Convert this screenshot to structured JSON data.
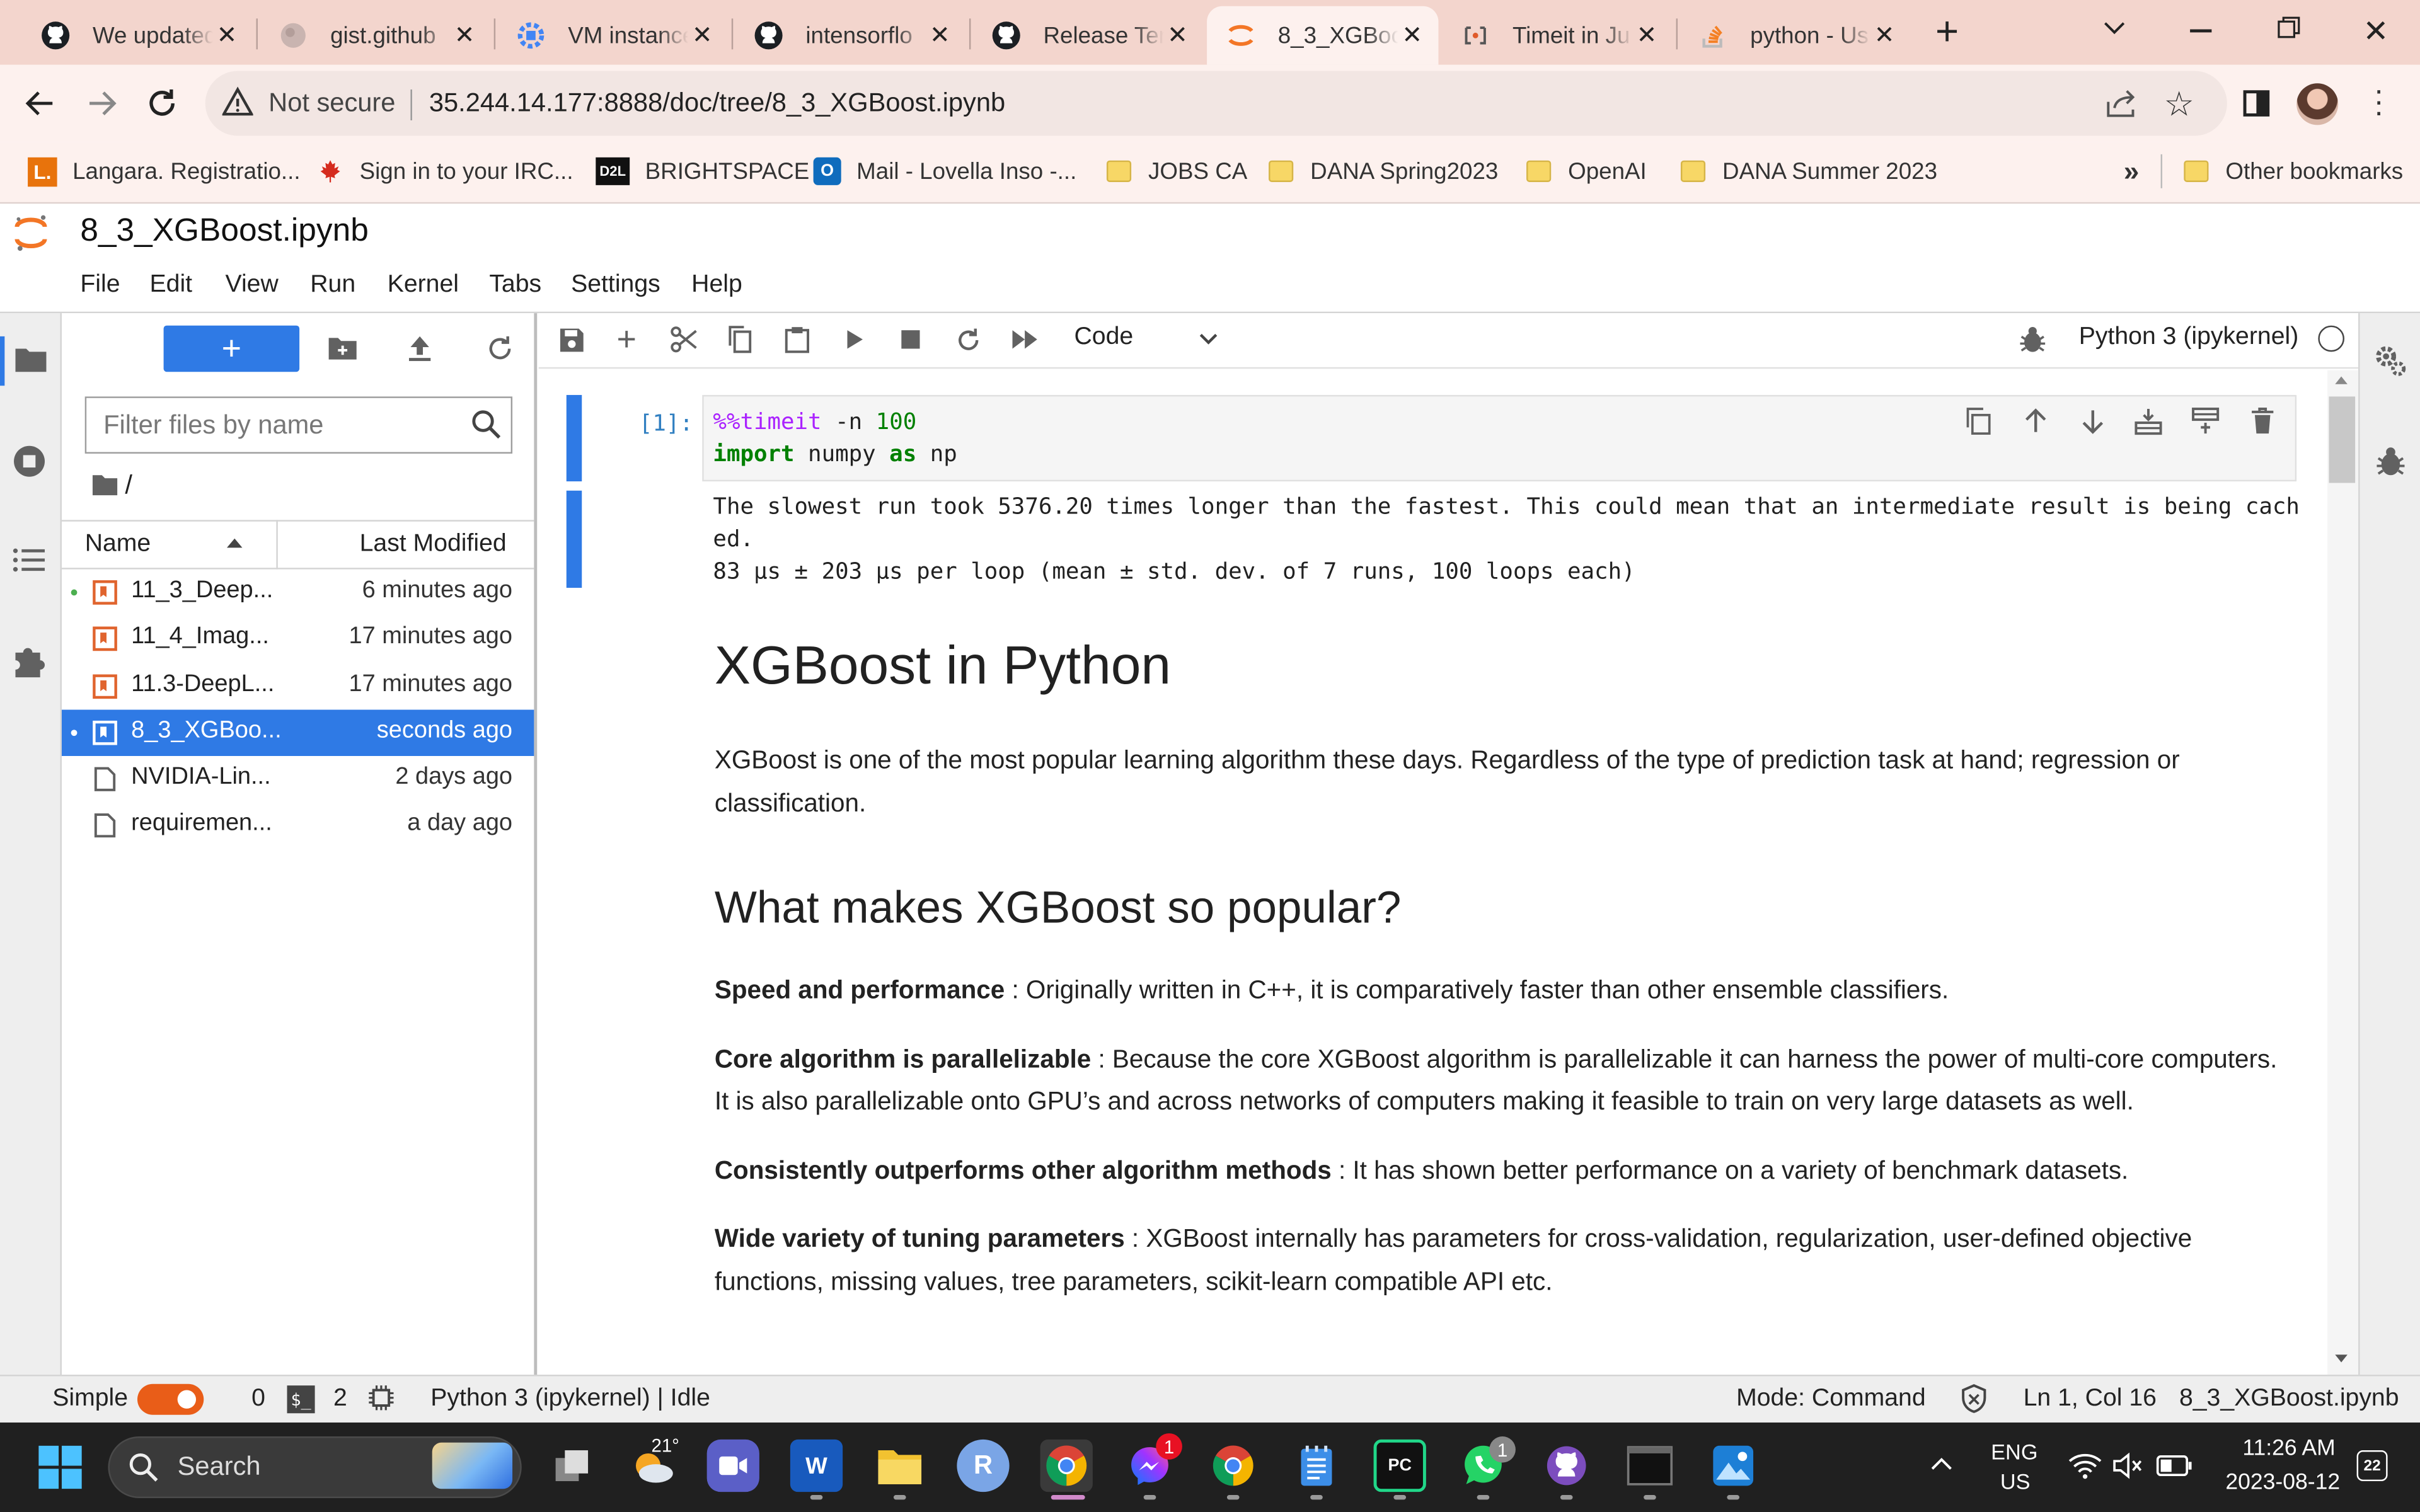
{
  "browser": {
    "tabs": [
      {
        "title": "We updated",
        "favicon": "github-icon"
      },
      {
        "title": "gist.github",
        "favicon": "globe-icon"
      },
      {
        "title": "VM instance",
        "favicon": "gcp-icon"
      },
      {
        "title": "intensorflo",
        "favicon": "github-icon"
      },
      {
        "title": "Release Ten",
        "favicon": "github-icon"
      },
      {
        "title": "8_3_XGBoo",
        "favicon": "jupyter-icon"
      },
      {
        "title": "Timeit in Ju",
        "favicon": "notebook-icon"
      },
      {
        "title": "python - Us",
        "favicon": "stackoverflow-icon"
      }
    ],
    "active_tab": 5,
    "security": "Not secure",
    "url": "35.244.14.177:8888/doc/tree/8_3_XGBoost.ipynb",
    "bookmarks": [
      {
        "label": "Langara. Registratio...",
        "icon": "langara-icon"
      },
      {
        "label": "Sign in to your IRC...",
        "icon": "maple-leaf-icon"
      },
      {
        "label": "BRIGHTSPACE",
        "icon": "d2l-icon"
      },
      {
        "label": "Mail - Lovella Inso -...",
        "icon": "outlook-icon"
      },
      {
        "label": "JOBS CA",
        "icon": "folder-icon"
      },
      {
        "label": "DANA Spring2023",
        "icon": "folder-icon"
      },
      {
        "label": "OpenAI",
        "icon": "folder-icon"
      },
      {
        "label": "DANA Summer 2023",
        "icon": "folder-icon"
      }
    ],
    "more_bookmarks": "»",
    "other_bookmarks": "Other bookmarks",
    "colors": {
      "tabstrip": "#f3d5cd",
      "toolbar": "#fdf1ee"
    }
  },
  "jupyter": {
    "doc_title": "8_3_XGBoost.ipynb",
    "menu": [
      "File",
      "Edit",
      "View",
      "Run",
      "Kernel",
      "Tabs",
      "Settings",
      "Help"
    ],
    "accent": "#2f7ae5",
    "filebrowser": {
      "new_button": "+",
      "filter_placeholder": "Filter files by name",
      "path": "/",
      "col_name": "Name",
      "col_modified": "Last Modified",
      "files": [
        {
          "name": "11_3_Deep...",
          "modified": "6 minutes ago",
          "type": "notebook",
          "running": true,
          "selected": false
        },
        {
          "name": "11_4_Imag...",
          "modified": "17 minutes ago",
          "type": "notebook",
          "running": false,
          "selected": false
        },
        {
          "name": "11.3-DeepL...",
          "modified": "17 minutes ago",
          "type": "notebook",
          "running": false,
          "selected": false
        },
        {
          "name": "8_3_XGBoo...",
          "modified": "seconds ago",
          "type": "notebook",
          "running": true,
          "selected": true
        },
        {
          "name": "NVIDIA-Lin...",
          "modified": "2 days ago",
          "type": "file",
          "running": false,
          "selected": false
        },
        {
          "name": "requiremen...",
          "modified": "a day ago",
          "type": "file",
          "running": false,
          "selected": false
        }
      ]
    },
    "toolbar": {
      "cell_type": "Code",
      "kernel": "Python 3 (ipykernel)"
    },
    "cell": {
      "prompt": "[1]:",
      "line1_magic": "%%timeit",
      "line1_rest": " -n ",
      "line1_num": "100",
      "line2_kw1": "import",
      "line2_mod": " numpy ",
      "line2_kw2": "as",
      "line2_alias": " np",
      "output_line1": "The slowest run took 5376.20 times longer than the fastest. This could mean that an intermediate result is being cach",
      "output_line2": "ed.",
      "output_line3": "83 µs ± 203 µs per loop (mean ± std. dev. of 7 runs, 100 loops each)"
    },
    "markdown": {
      "h1": "XGBoost in Python",
      "intro": "XGBoost is one of the most popular learning algorithm these days. Regardless of the type of prediction task at hand; regression or classification.",
      "h2": "What makes XGBoost so popular?",
      "items": [
        {
          "term": "Speed and performance",
          "text": " : Originally written in C++, it is comparatively faster than other ensemble classifiers."
        },
        {
          "term": "Core algorithm is parallelizable",
          "text": " : Because the core XGBoost algorithm is parallelizable it can harness the power of multi-core computers. It is also parallelizable onto GPU’s and across networks of computers making it feasible to train on very large datasets as well."
        },
        {
          "term": "Consistently outperforms other algorithm methods",
          "text": " : It has shown better performance on a variety of benchmark datasets."
        },
        {
          "term": "Wide variety of tuning parameters",
          "text": " : XGBoost internally has parameters for cross-validation, regularization, user-defined objective functions, missing values, tree parameters, scikit-learn compatible API etc."
        }
      ]
    },
    "status": {
      "simple_label": "Simple",
      "terminals": "0",
      "kernels": "2",
      "kernel_status": "Python 3 (ipykernel) | Idle",
      "mode": "Mode: Command",
      "cursor": "Ln 1, Col 16",
      "file": "8_3_XGBoost.ipynb"
    }
  },
  "taskbar": {
    "search_label": "Search",
    "weather_temp": "21°",
    "lang_line1": "ENG",
    "lang_line2": "US",
    "time": "11:26 AM",
    "date": "2023-08-12",
    "notif_count": "22",
    "messenger_badge": "1",
    "whatsapp_badge": "1",
    "word_label": "W",
    "r_label": "R",
    "pc_label": "PC"
  }
}
